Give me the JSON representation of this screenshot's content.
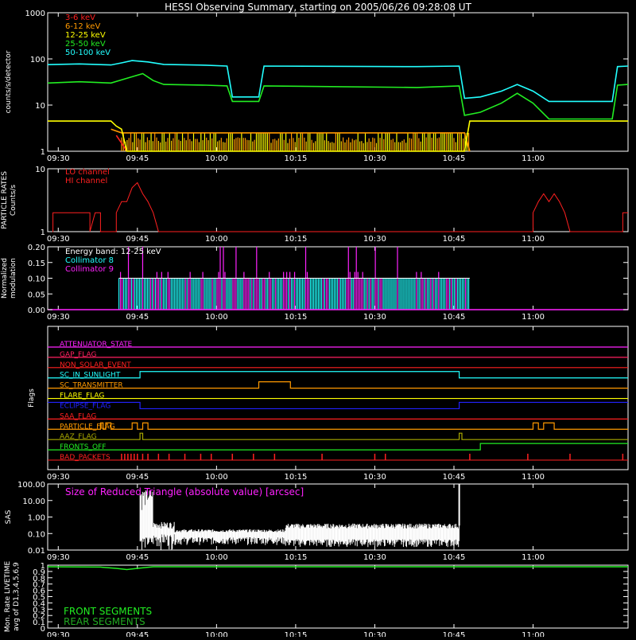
{
  "title": "HESSI Observing Summary, starting on 2005/06/26 09:28:08 UT",
  "time_ticks": [
    "09:30",
    "09:45",
    "10:00",
    "10:15",
    "10:30",
    "10:45",
    "11:00"
  ],
  "chart_data": [
    {
      "type": "line",
      "name": "count-rates",
      "ylabel": "counts/s/detector",
      "yscale": "log",
      "ylim": [
        1,
        1000
      ],
      "yticks": [
        "1",
        "10",
        "100",
        "1000"
      ],
      "legend": [
        {
          "name": "3-6 keV",
          "color": "#ff2020"
        },
        {
          "name": "6-12 keV",
          "color": "#ff9900"
        },
        {
          "name": "12-25 keV",
          "color": "#ffff00"
        },
        {
          "name": "25-50 keV",
          "color": "#22ee22"
        },
        {
          "name": "50-100 keV",
          "color": "#22ffff"
        }
      ],
      "series": [
        {
          "name": "50-100 keV",
          "color": "#22ffff",
          "points": [
            [
              0,
              75
            ],
            [
              6,
              78
            ],
            [
              12,
              74
            ],
            [
              14,
              82
            ],
            [
              16,
              92
            ],
            [
              19,
              86
            ],
            [
              22,
              76
            ],
            [
              30,
              73
            ],
            [
              34,
              70
            ],
            [
              35,
              15
            ],
            [
              40,
              15
            ],
            [
              41,
              70
            ],
            [
              70,
              68
            ],
            [
              78,
              70
            ],
            [
              79,
              14
            ],
            [
              82,
              15
            ],
            [
              86,
              20
            ],
            [
              89,
              28
            ],
            [
              92,
              20
            ],
            [
              95,
              12
            ],
            [
              107,
              12
            ],
            [
              108,
              68
            ],
            [
              110,
              70
            ]
          ]
        },
        {
          "name": "25-50 keV",
          "color": "#22ee22",
          "points": [
            [
              0,
              30
            ],
            [
              6,
              32
            ],
            [
              12,
              30
            ],
            [
              15,
              38
            ],
            [
              18,
              48
            ],
            [
              20,
              34
            ],
            [
              22,
              28
            ],
            [
              30,
              27
            ],
            [
              34,
              26
            ],
            [
              35,
              12
            ],
            [
              40,
              12
            ],
            [
              41,
              26
            ],
            [
              70,
              24
            ],
            [
              78,
              26
            ],
            [
              79,
              6
            ],
            [
              82,
              7
            ],
            [
              86,
              11
            ],
            [
              89,
              18
            ],
            [
              92,
              11
            ],
            [
              95,
              5
            ],
            [
              107,
              5
            ],
            [
              108,
              27
            ],
            [
              110,
              28
            ]
          ]
        },
        {
          "name": "12-25 keV",
          "color": "#ffff00",
          "points": [
            [
              0,
              4.5
            ],
            [
              12,
              4.5
            ],
            [
              13,
              3.5
            ],
            [
              14,
              3
            ],
            [
              15,
              1
            ],
            [
              79,
              1
            ],
            [
              80,
              4.5
            ],
            [
              107,
              4.5
            ],
            [
              108,
              4.5
            ],
            [
              110,
              4.5
            ]
          ]
        },
        {
          "name": "6-12 keV",
          "color": "#ff9900",
          "points": [
            [
              12,
              3
            ],
            [
              14,
              2.5
            ],
            [
              79,
              2.5
            ],
            [
              80,
              1
            ]
          ]
        },
        {
          "name": "3-6 keV",
          "color": "#ff2020",
          "points": [
            [
              13,
              2.2
            ],
            [
              14,
              1.5
            ],
            [
              15,
              1
            ]
          ]
        }
      ]
    },
    {
      "type": "line",
      "name": "particle-rates",
      "ylabel": "PARTICLE RATES Counts/s",
      "yscale": "log",
      "ylim": [
        1,
        10
      ],
      "yticks": [
        "1",
        "10"
      ],
      "legend": [
        {
          "name": "LO channel",
          "color": "#ff2020"
        },
        {
          "name": "HI channel",
          "color": "#ff2020"
        }
      ],
      "series": [
        {
          "name": "LO channel",
          "color": "#ff2020",
          "points": [
            [
              0,
              1
            ],
            [
              1,
              1
            ],
            [
              1,
              2
            ],
            [
              8,
              2
            ],
            [
              8,
              1
            ],
            [
              9,
              2
            ],
            [
              10,
              2
            ],
            [
              10,
              1
            ],
            [
              13,
              1
            ],
            [
              13,
              2
            ],
            [
              14,
              3
            ],
            [
              15,
              3
            ],
            [
              16,
              5
            ],
            [
              17,
              6
            ],
            [
              18,
              4
            ],
            [
              19,
              3
            ],
            [
              20,
              2
            ],
            [
              21,
              1
            ],
            [
              92,
              1
            ],
            [
              92,
              2
            ],
            [
              93,
              3
            ],
            [
              94,
              4
            ],
            [
              95,
              3
            ],
            [
              96,
              4
            ],
            [
              97,
              3
            ],
            [
              98,
              2
            ],
            [
              99,
              1
            ],
            [
              109,
              1
            ],
            [
              109,
              2
            ],
            [
              110,
              2
            ]
          ]
        }
      ]
    },
    {
      "type": "line",
      "name": "modulation",
      "ylabel": "Normalized modulation",
      "ylim": [
        0,
        0.2
      ],
      "yticks": [
        "0.00",
        "0.05",
        "0.10",
        "0.15",
        "0.20"
      ],
      "legend": [
        {
          "name": "Energy band: 12-25 keV",
          "color": "#ffffff"
        },
        {
          "name": "Collimator 8",
          "color": "#22ffff"
        },
        {
          "name": "Collimator 9",
          "color": "#ff22ff"
        }
      ],
      "band": {
        "start": 13.5,
        "end": 80,
        "level": 0.1
      }
    },
    {
      "type": "line",
      "name": "flags",
      "ylabel": "Flags",
      "flags": [
        {
          "label": "ATTENUATOR_STATE",
          "color": "#ff22ff",
          "steps": []
        },
        {
          "label": "GAP_FLAG",
          "color": "#ff2060",
          "steps": []
        },
        {
          "label": "NON_SOLAR_EVENT",
          "color": "#ff2020",
          "steps": []
        },
        {
          "label": "SC_IN_SUNLIGHT",
          "color": "#22ffff",
          "steps": [
            [
              0,
              0
            ],
            [
              17.5,
              1
            ],
            [
              78,
              0
            ]
          ]
        },
        {
          "label": "SC_TRANSMITTER",
          "color": "#ff9900",
          "steps": [
            [
              0,
              0
            ],
            [
              40,
              1
            ],
            [
              46,
              0
            ]
          ]
        },
        {
          "label": "FLARE_FLAG",
          "color": "#ffff00",
          "steps": []
        },
        {
          "label": "ECLIPSE_FLAG",
          "color": "#2222ff",
          "steps": [
            [
              0,
              1
            ],
            [
              17.5,
              0
            ],
            [
              78,
              1
            ]
          ]
        },
        {
          "label": "SAA_FLAG",
          "color": "#ff2020",
          "steps": []
        },
        {
          "label": "PARTICLE_FLAG",
          "color": "#ff9900",
          "steps": [
            [
              0,
              0
            ],
            [
              10,
              1
            ],
            [
              10.5,
              0
            ],
            [
              11,
              1
            ],
            [
              12,
              0
            ],
            [
              16,
              1
            ],
            [
              17,
              0
            ],
            [
              18,
              1
            ],
            [
              19,
              0
            ],
            [
              92,
              1
            ],
            [
              93,
              0
            ],
            [
              94,
              1
            ],
            [
              96,
              0
            ]
          ]
        },
        {
          "label": "AAZ_FLAG",
          "color": "#aaaa00",
          "steps": [
            [
              0,
              0
            ],
            [
              17.5,
              1
            ],
            [
              18,
              0
            ],
            [
              78,
              1
            ],
            [
              78.5,
              0
            ]
          ]
        },
        {
          "label": "FRONTS_OFF",
          "color": "#22ee22",
          "steps": [
            [
              0,
              0
            ],
            [
              82,
              1
            ]
          ]
        },
        {
          "label": "BAD_PACKETS",
          "color": "#ff2020",
          "spikes": [
            14,
            14.6,
            15.2,
            15.8,
            16.4,
            17,
            18,
            19,
            21,
            23,
            26,
            29,
            31,
            35,
            39,
            43,
            52,
            62,
            64,
            80,
            91,
            99,
            109
          ]
        }
      ]
    },
    {
      "type": "line",
      "name": "sas",
      "ylabel": "SAS",
      "yscale": "log",
      "ylim": [
        0.01,
        100
      ],
      "yticks": [
        "0.01",
        "0.10",
        "1.00",
        "10.00",
        "100.00"
      ],
      "annotation": "Size of Reduced Triangle (absolute value) [arcsec]",
      "span": {
        "start": 17.5,
        "end": 78
      }
    },
    {
      "type": "line",
      "name": "livetime",
      "ylabel": "Mon. Rate LIVETIME avg of D1,3,4,5,6,9",
      "ylim": [
        0,
        1
      ],
      "yticks": [
        "0",
        "0.1",
        "0.2",
        "0.3",
        "0.4",
        "0.5",
        "0.6",
        "0.7",
        "0.8",
        "0.9",
        "1"
      ],
      "legend": [
        {
          "name": "FRONT SEGMENTS",
          "color": "#22ee22"
        },
        {
          "name": "REAR SEGMENTS",
          "color": "#22aa22"
        }
      ],
      "series": [
        {
          "name": "FRONT SEGMENTS",
          "color": "#22ee22",
          "points": [
            [
              0,
              0.975
            ],
            [
              10,
              0.97
            ],
            [
              13,
              0.95
            ],
            [
              15,
              0.93
            ],
            [
              17,
              0.95
            ],
            [
              20,
              0.975
            ],
            [
              110,
              0.975
            ]
          ]
        }
      ]
    }
  ]
}
